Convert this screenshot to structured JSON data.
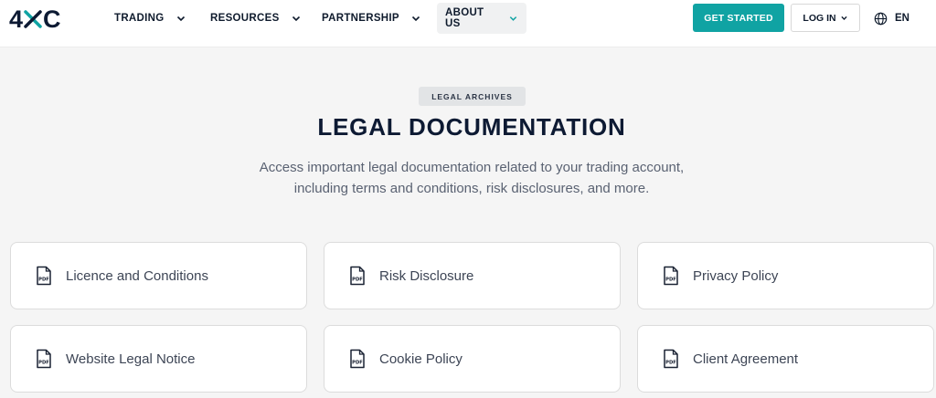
{
  "header": {
    "logo_text": "4XC",
    "nav": [
      {
        "label": "TRADING"
      },
      {
        "label": "RESOURCES"
      },
      {
        "label": "PARTNERSHIP"
      },
      {
        "label": "ABOUT US"
      }
    ],
    "get_started_label": "GET STARTED",
    "login_label": "LOG IN",
    "language_label": "EN"
  },
  "hero": {
    "badge": "LEGAL ARCHIVES",
    "title": "LEGAL DOCUMENTATION",
    "subtitle": "Access important legal documentation related to your trading account, including terms and conditions, risk disclosures, and more."
  },
  "documents": [
    {
      "label": "Licence and Conditions",
      "icon": "pdf-icon"
    },
    {
      "label": "Risk Disclosure",
      "icon": "pdf-icon"
    },
    {
      "label": "Privacy Policy",
      "icon": "pdf-icon"
    },
    {
      "label": "Website Legal Notice",
      "icon": "pdf-icon"
    },
    {
      "label": "Cookie Policy",
      "icon": "pdf-icon"
    },
    {
      "label": "Client Agreement",
      "icon": "pdf-icon"
    }
  ],
  "colors": {
    "accent": "#10a3a3",
    "navy": "#0d1a33",
    "background": "#f5f5f5"
  }
}
